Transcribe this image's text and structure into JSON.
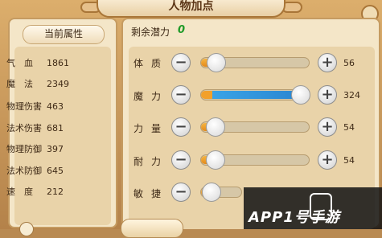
{
  "window": {
    "title": "人物加点"
  },
  "left_panel": {
    "header": "当前属性",
    "stats": [
      {
        "label": "气　血",
        "value": "1861"
      },
      {
        "label": "魔　法",
        "value": "2349"
      },
      {
        "label": "物理伤害",
        "value": "463"
      },
      {
        "label": "法术伤害",
        "value": "681"
      },
      {
        "label": "物理防御",
        "value": "397"
      },
      {
        "label": "法术防御",
        "value": "645"
      },
      {
        "label": "速　度",
        "value": "212"
      }
    ]
  },
  "right_panel": {
    "potential_label": "剩余潜力",
    "potential_value": "0",
    "attributes": [
      {
        "name": "体质",
        "value": "56",
        "level": 0.06
      },
      {
        "name": "魔力",
        "value": "324",
        "level": 1.0
      },
      {
        "name": "力量",
        "value": "54",
        "level": 0.05
      },
      {
        "name": "耐力",
        "value": "54",
        "level": 0.05
      },
      {
        "name": "敏捷",
        "value": "",
        "level": 0.05
      }
    ],
    "minus_symbol": "−",
    "plus_symbol": "+"
  },
  "watermark": {
    "text": "APP1号手游"
  },
  "colors": {
    "potential": "#1f9a28",
    "bar_blue": "#2a86d1",
    "bar_orange": "#f2a02a",
    "panel": "#f4e6c8"
  }
}
